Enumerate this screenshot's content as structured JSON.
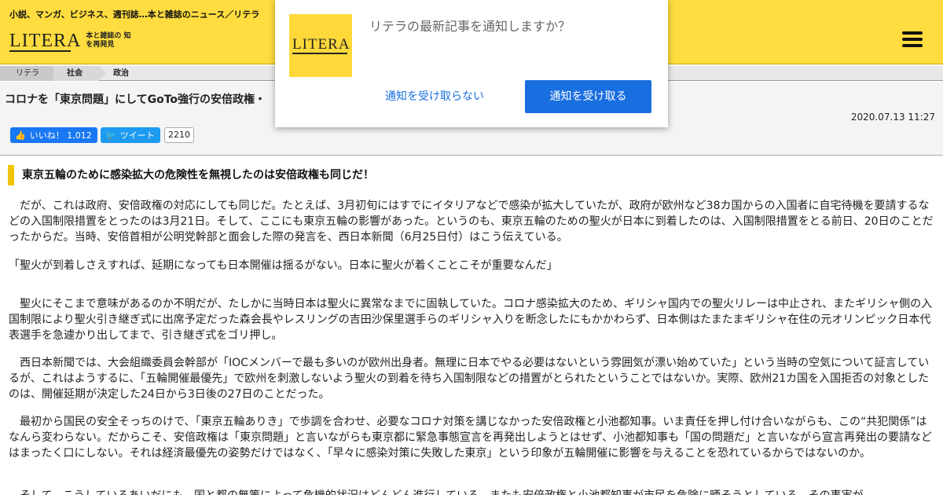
{
  "header": {
    "tagline": "小説、マンガ、ビジネス、週刊誌…本と雑誌のニュース／リテラ",
    "logo_text": "LITERA",
    "logo_sub": "本と雑誌の 知を再発見"
  },
  "breadcrumb": {
    "items": [
      "リテラ",
      "社会",
      "政治"
    ]
  },
  "article": {
    "title": "コロナを「東京問題」にしてGoTo強行の安倍政権・",
    "date": "2020.07.13 11:27",
    "fb_label": "いいね！ 1,012",
    "tw_label": "ツイート",
    "tw_count": "2210",
    "section_heading": "東京五輪のために感染拡大の危険性を無視したのは安倍政権も同じだ！",
    "paragraphs": [
      "　だが、これは政府、安倍政権の対応にしても同じだ。たとえば、3月初旬にはすでにイタリアなどで感染が拡大していたが、政府が欧州など38カ国からの入国者に自宅待機を要請するなどの入国制限措置をとったのは3月21日。そして、ここにも東京五輪の影響があった。というのも、東京五輪のための聖火が日本に到着したのは、入国制限措置をとる前日、20日のことだったからだ。当時、安倍首相が公明党幹部と面会した際の発言を、西日本新聞（6月25日付）はこう伝えている。",
      "「聖火が到着しさえすれば、延期になっても日本開催は揺るがない。日本に聖火が着くことこそが重要なんだ」",
      "　聖火にそこまで意味があるのか不明だが、たしかに当時日本は聖火に異常なまでに固執していた。コロナ感染拡大のため、ギリシャ国内での聖火リレーは中止され、またギリシャ側の入国制限により聖火引き継ぎ式に出席予定だった森会長やレスリングの吉田沙保里選手らのギリシャ入りを断念したにもかかわらず、日本側はたまたまギリシャ在住の元オリンピック日本代表選手を急遽かり出してまで、引き継ぎ式をゴリ押し。",
      "　西日本新聞では、大会組織委員会幹部が「IOCメンバーで最も多いのが欧州出身者。無理に日本でやる必要はないという雰囲気が漂い始めていた」という当時の空気について証言しているが、これはようするに、「五輪開催最優先」で欧州を刺激しないよう聖火の到着を待ち入国制限などの措置がとられたということではないか。実際、欧州21カ国を入国拒否の対象としたのは、開催延期が決定した24日から3日後の27日のことだった。",
      "　最初から国民の安全そっちのけで、「東京五輪ありき」で歩調を合わせ、必要なコロナ対策を講じなかった安倍政権と小池都知事。いま責任を押し付け合いながらも、この“共犯関係”はなんら変わらない。だからこそ、安倍政権は「東京問題」と言いながらも東京都に緊急事態宣言を再発出しようとはせず、小池都知事も「国の問題だ」と言いながら宣言再発出の要請などはまったく口にしない。それは経済最優先の姿勢だけではなく、「早々に感染対策に失敗した東京」という印象が五輪開催に影響を与えることを恐れているからではないのか。",
      "　そして、こうしているあいだにも、国と都の無策によって危機的状況はどんどん進行している。またも安倍政権と小池都知事が市民を危険に晒そうとしている。その事実が"
    ]
  },
  "popup": {
    "logo_text": "LITERA",
    "message": "リテラの最新記事を通知しますか？",
    "deny_label": "通知を受け取らない",
    "allow_label": "通知を受け取る"
  },
  "colors": {
    "brand_yellow": "#ffdc3f",
    "accent_blue": "#1a6fe0",
    "facebook_blue": "#1877f2",
    "twitter_blue": "#1d9bf0"
  }
}
